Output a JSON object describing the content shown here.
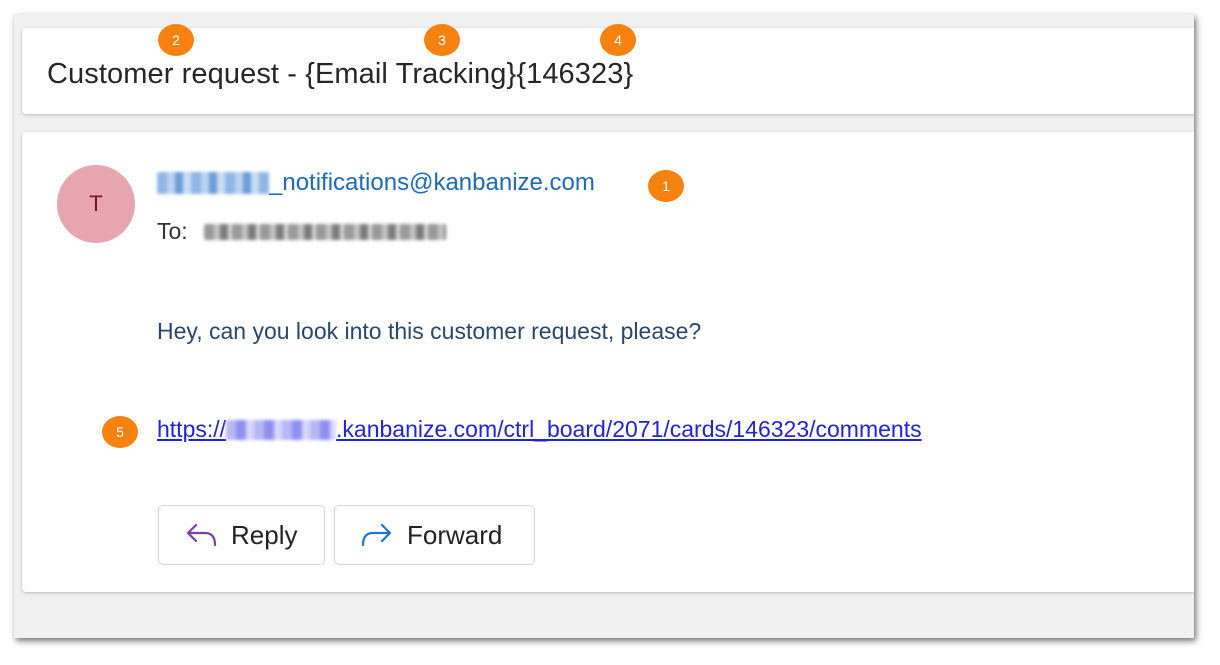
{
  "subject": {
    "prefix": "Customer request - ",
    "tracking": "{Email Tracking}",
    "card_id": "{146323}"
  },
  "sender": {
    "avatar_letter": "T",
    "email_visible": "_notifications@kanbanize.com"
  },
  "recipient": {
    "to_label": "To:"
  },
  "message": {
    "text": "Hey, can you look into this customer request, please?",
    "link_prefix": "https://",
    "link_suffix": ".kanbanize.com/ctrl_board/2071/cards/146323/comments"
  },
  "actions": {
    "reply_label": "Reply",
    "forward_label": "Forward"
  },
  "callouts": [
    "1",
    "2",
    "3",
    "4",
    "5"
  ],
  "colors": {
    "callout": "#f7820f",
    "sender": "#1f6ab4",
    "link": "#2323cf",
    "avatar_bg": "#e6a6ad",
    "reply_icon": "#7b3f9e",
    "forward_icon": "#1f77c9"
  },
  "icons": {
    "reply": "reply-arrow-icon",
    "forward": "forward-arrow-icon"
  }
}
